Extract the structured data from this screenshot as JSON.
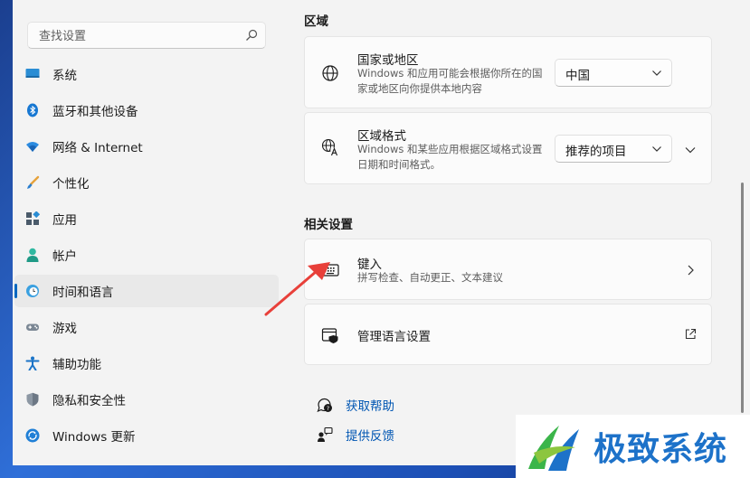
{
  "search": {
    "placeholder": "查找设置"
  },
  "sidebar": {
    "items": [
      {
        "label": "系统",
        "icon": "monitor-icon"
      },
      {
        "label": "蓝牙和其他设备",
        "icon": "bluetooth-icon"
      },
      {
        "label": "网络 & Internet",
        "icon": "wifi-icon"
      },
      {
        "label": "个性化",
        "icon": "brush-icon"
      },
      {
        "label": "应用",
        "icon": "apps-icon"
      },
      {
        "label": "帐户",
        "icon": "person-icon"
      },
      {
        "label": "时间和语言",
        "icon": "clock-globe-icon",
        "active": true
      },
      {
        "label": "游戏",
        "icon": "gamepad-icon"
      },
      {
        "label": "辅助功能",
        "icon": "accessibility-icon"
      },
      {
        "label": "隐私和安全性",
        "icon": "shield-icon"
      },
      {
        "label": "Windows 更新",
        "icon": "update-icon"
      }
    ]
  },
  "main": {
    "region_title": "区域",
    "country": {
      "title": "国家或地区",
      "desc": "Windows 和应用可能会根据你所在的国家或地区向你提供本地内容",
      "value": "中国"
    },
    "format": {
      "title": "区域格式",
      "desc": "Windows 和某些应用根据区域格式设置日期和时间格式。",
      "value": "推荐的项目"
    },
    "related_title": "相关设置",
    "typing": {
      "title": "键入",
      "desc": "拼写检查、自动更正、文本建议"
    },
    "language": {
      "title": "管理语言设置"
    },
    "help": "获取帮助",
    "feedback": "提供反馈"
  },
  "watermark": {
    "text": "极致系统"
  },
  "colors": {
    "accent": "#0067c0",
    "link": "#0056b3",
    "arrow": "#e8403a"
  }
}
